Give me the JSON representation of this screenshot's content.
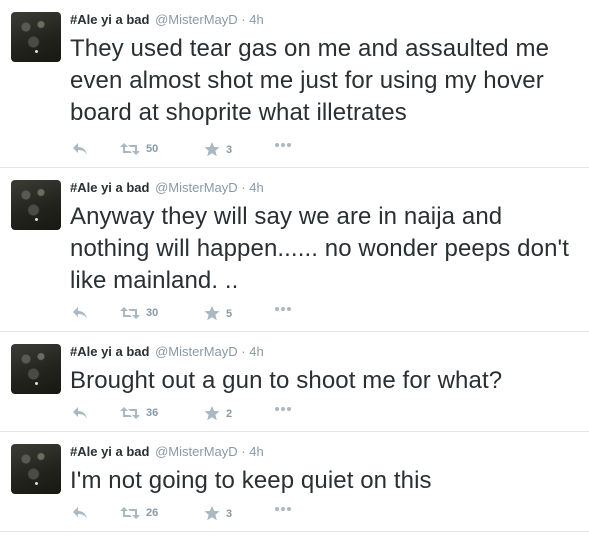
{
  "tweets": [
    {
      "fullname": "#Ale yi a bad",
      "username": "@MisterMayD",
      "separator": "·",
      "time": "4h",
      "text": "They used tear gas on me and assaulted me even almost shot me just for using my hover board at shoprite what illetrates",
      "retweets": "50",
      "favorites": "3"
    },
    {
      "fullname": "#Ale yi a bad",
      "username": "@MisterMayD",
      "separator": "·",
      "time": "4h",
      "text": "Anyway they will say we are in naija and nothing will happen...... no wonder peeps don't like mainland. ..",
      "retweets": "30",
      "favorites": "5"
    },
    {
      "fullname": "#Ale yi a bad",
      "username": "@MisterMayD",
      "separator": "·",
      "time": "4h",
      "text": "Brought out a gun to shoot me for what?",
      "retweets": "36",
      "favorites": "2"
    },
    {
      "fullname": "#Ale yi a bad",
      "username": "@MisterMayD",
      "separator": "·",
      "time": "4h",
      "text": "I'm not going to keep quiet on this",
      "retweets": "26",
      "favorites": "3"
    }
  ],
  "icons": {
    "reply": "reply-icon",
    "retweet": "retweet-icon",
    "favorite": "star-icon",
    "more": "more-dots-icon"
  },
  "colors": {
    "text": "#292f33",
    "meta": "#8899a6",
    "icon": "#aab8c2",
    "divider": "#e1e8ed"
  }
}
